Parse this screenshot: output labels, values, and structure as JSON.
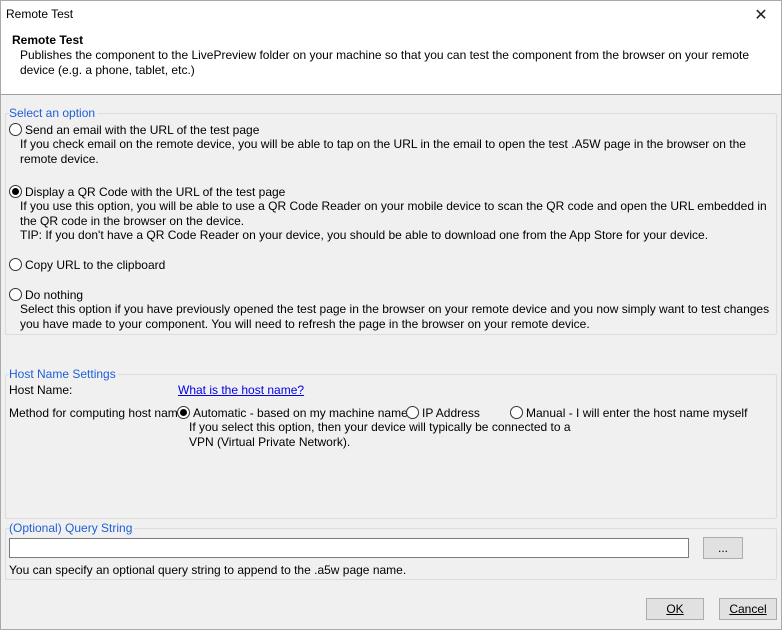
{
  "window": {
    "title": "Remote Test",
    "close_glyph": "✕"
  },
  "header": {
    "title": "Remote Test",
    "description": "Publishes the component to the LivePreview folder on your machine so that you can test the component from the browser on your remote device (e.g. a phone, tablet, etc.)"
  },
  "options_group": {
    "legend": "Select an option",
    "options": [
      {
        "label": "Send an email with the URL of the test page",
        "checked": false,
        "description": "If you check email on the remote device, you will be able to tap on the URL in the email to open the test .A5W page in the browser on the remote device."
      },
      {
        "label": "Display a QR Code with the URL of the test page",
        "checked": true,
        "description": "If you use this option, you will be able to use a QR Code Reader on your mobile device to scan the QR code and open the URL embedded in the QR code in the browser on the device.",
        "tip": "TIP: If you don't have a QR Code Reader on your device, you should be able to download one from the App Store for your device."
      },
      {
        "label": "Copy URL to the clipboard",
        "checked": false
      },
      {
        "label": "Do nothing",
        "checked": false,
        "description": "Select this option if you have previously opened the test page in the browser on your remote device and you now simply want to test changes you have made to your component. You will need to refresh the page in the browser on your remote device."
      }
    ]
  },
  "host_group": {
    "legend": "Host Name Settings",
    "host_name_label": "Host Name:",
    "host_name_link": "What is the host name?",
    "method_label": "Method for computing host name:",
    "methods": [
      {
        "label": "Automatic - based on my machine name",
        "checked": true
      },
      {
        "label": "IP Address",
        "checked": false
      },
      {
        "label": "Manual - I will enter the host name myself",
        "checked": false
      }
    ],
    "method_note": "If you select this option, then your device will typically be connected to a VPN (Virtual Private Network)."
  },
  "query_group": {
    "legend": "(Optional) Query String",
    "value": "",
    "browse_label": "...",
    "hint": "You can specify an optional query string to append to the .a5w page name."
  },
  "footer": {
    "ok_label": "OK",
    "cancel_label": "Cancel"
  }
}
